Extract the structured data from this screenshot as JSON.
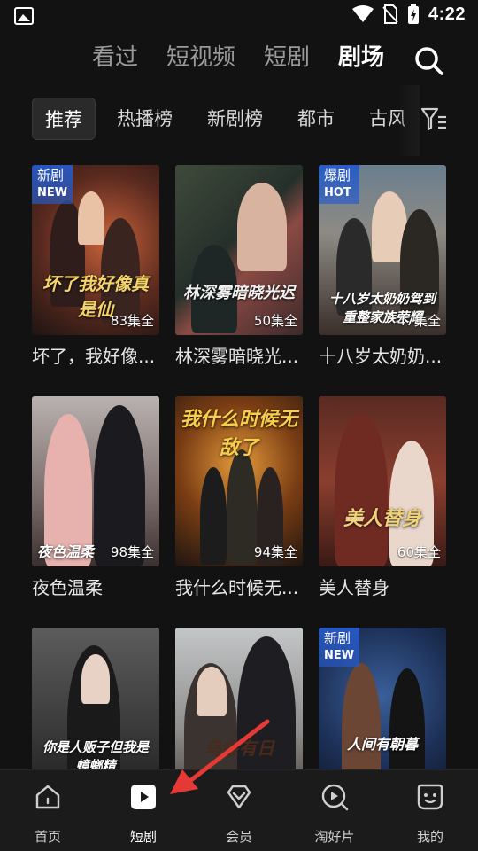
{
  "status_bar": {
    "time": "4:22"
  },
  "top_tabs": [
    {
      "label": "看过",
      "active": false
    },
    {
      "label": "短视频",
      "active": false
    },
    {
      "label": "短剧",
      "active": false
    },
    {
      "label": "剧场",
      "active": true
    }
  ],
  "categories": [
    {
      "label": "推荐",
      "active": true
    },
    {
      "label": "热播榜",
      "active": false
    },
    {
      "label": "新剧榜",
      "active": false
    },
    {
      "label": "都市",
      "active": false
    },
    {
      "label": "古风",
      "active": false
    }
  ],
  "dramas": [
    {
      "title": "坏了，我好像...",
      "episodes": "83集全",
      "badge": "新剧",
      "badge_en": "NEW",
      "art_title": "坏了我好像真是仙"
    },
    {
      "title": "林深雾暗晓光...",
      "episodes": "50集全",
      "badge": "",
      "badge_en": "",
      "art_title": "林深雾暗晓光迟"
    },
    {
      "title": "十八岁太奶奶...",
      "episodes": "47集全",
      "badge": "爆剧",
      "badge_en": "HOT",
      "art_title": "十八岁太奶奶驾到重整家族荣耀"
    },
    {
      "title": "夜色温柔",
      "episodes": "98集全",
      "badge": "",
      "badge_en": "",
      "art_title": "夜色温柔"
    },
    {
      "title": "我什么时候无...",
      "episodes": "94集全",
      "badge": "",
      "badge_en": "",
      "art_title": "我什么时候无敌了"
    },
    {
      "title": "美人替身",
      "episodes": "60集全",
      "badge": "",
      "badge_en": "",
      "art_title": "美人替身"
    },
    {
      "title": "",
      "episodes": "",
      "badge": "",
      "badge_en": "",
      "art_title": "你是人贩子但我是蟑螂精"
    },
    {
      "title": "",
      "episodes": "",
      "badge": "",
      "badge_en": "",
      "art_title": "乌金有日"
    },
    {
      "title": "",
      "episodes": "",
      "badge": "新剧",
      "badge_en": "NEW",
      "art_title": "人间有朝暮"
    }
  ],
  "bottom_nav": [
    {
      "label": "首页",
      "icon": "home-icon",
      "active": false
    },
    {
      "label": "短剧",
      "icon": "play-icon",
      "active": true
    },
    {
      "label": "会员",
      "icon": "diamond-icon",
      "active": false
    },
    {
      "label": "淘好片",
      "icon": "search-play-icon",
      "active": false
    },
    {
      "label": "我的",
      "icon": "smile-face-icon",
      "active": false
    }
  ],
  "colors": {
    "background": "#121212",
    "badge_blue": "#2d5ac8",
    "annotation_red": "#e53935"
  }
}
